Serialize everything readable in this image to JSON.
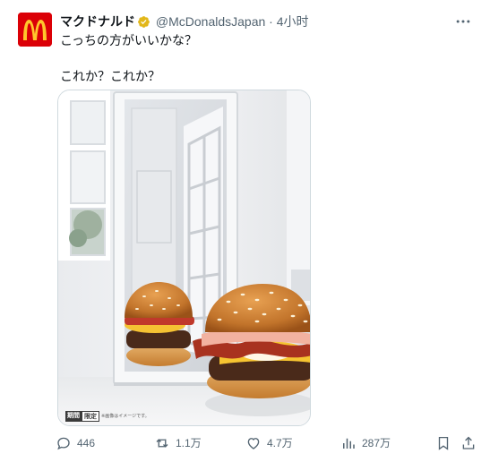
{
  "tweet": {
    "author_name": "マクドナルド",
    "handle": "@McDonaldsJapan",
    "separator": "·",
    "time": "4小时",
    "text": "こっちの方がいいかな？\n\nこれか？これか？",
    "verified_color": "#e2b719",
    "brand_color": "#db0007",
    "logo_color": "#ffc72c"
  },
  "media": {
    "badge_left": "期間",
    "badge_right": "限定",
    "disclaimer": "※画像はイメージです。"
  },
  "actions": {
    "replies": "446",
    "retweets": "1.1万",
    "likes": "4.7万",
    "views": "287万"
  }
}
